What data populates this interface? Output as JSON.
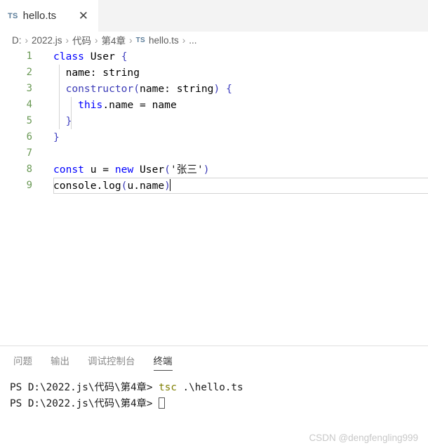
{
  "tabbar": {
    "tabs": [
      {
        "icon_label": "TS",
        "label": "hello.ts",
        "close_label": "✕"
      }
    ]
  },
  "breadcrumb": {
    "separator": "›",
    "ts_badge": "TS",
    "items": [
      "D:",
      "2022.js",
      "代码",
      "第4章",
      "hello.ts",
      "..."
    ]
  },
  "editor": {
    "lines": [
      {
        "num": "1",
        "segments": [
          {
            "t": "class",
            "c": "tok-kw"
          },
          {
            "t": " ",
            "c": "tok-plain"
          },
          {
            "t": "User",
            "c": "tok-plain"
          },
          {
            "t": " ",
            "c": "tok-plain"
          },
          {
            "t": "{",
            "c": "tok-brace"
          }
        ]
      },
      {
        "num": "2",
        "segments": [
          {
            "t": "  name: string",
            "c": "tok-plain"
          }
        ]
      },
      {
        "num": "3",
        "segments": [
          {
            "t": "  ",
            "c": "tok-plain"
          },
          {
            "t": "constructor",
            "c": "tok-fn"
          },
          {
            "t": "(",
            "c": "tok-paren"
          },
          {
            "t": "name: string",
            "c": "tok-plain"
          },
          {
            "t": ")",
            "c": "tok-paren"
          },
          {
            "t": " ",
            "c": "tok-plain"
          },
          {
            "t": "{",
            "c": "tok-brace"
          }
        ]
      },
      {
        "num": "4",
        "segments": [
          {
            "t": "    ",
            "c": "tok-plain"
          },
          {
            "t": "this",
            "c": "tok-this"
          },
          {
            "t": ".name = name",
            "c": "tok-plain"
          }
        ]
      },
      {
        "num": "5",
        "segments": [
          {
            "t": "  ",
            "c": "tok-plain"
          },
          {
            "t": "}",
            "c": "tok-brace"
          }
        ]
      },
      {
        "num": "6",
        "segments": [
          {
            "t": "}",
            "c": "tok-brace"
          }
        ]
      },
      {
        "num": "7",
        "segments": [
          {
            "t": "",
            "c": "tok-plain"
          }
        ]
      },
      {
        "num": "8",
        "segments": [
          {
            "t": "const",
            "c": "tok-kw"
          },
          {
            "t": " u = ",
            "c": "tok-plain"
          },
          {
            "t": "new",
            "c": "tok-kw"
          },
          {
            "t": " User",
            "c": "tok-plain"
          },
          {
            "t": "(",
            "c": "tok-paren"
          },
          {
            "t": "'张三'",
            "c": "tok-str"
          },
          {
            "t": ")",
            "c": "tok-paren"
          }
        ]
      },
      {
        "num": "9",
        "active": true,
        "cursor": true,
        "segments": [
          {
            "t": "console.log",
            "c": "tok-plain"
          },
          {
            "t": "(",
            "c": "tok-paren"
          },
          {
            "t": "u.name",
            "c": "tok-plain"
          },
          {
            "t": ")",
            "c": "tok-paren"
          }
        ]
      }
    ]
  },
  "panel": {
    "tabs": [
      {
        "label": "问题",
        "active": false
      },
      {
        "label": "输出",
        "active": false
      },
      {
        "label": "调试控制台",
        "active": false
      },
      {
        "label": "终端",
        "active": true
      }
    ],
    "terminal": {
      "lines": [
        {
          "prompt": "PS D:\\2022.js\\代码\\第4章> ",
          "command": "tsc",
          "arg": " .\\hello.ts",
          "cursor": false
        },
        {
          "prompt": "PS D:\\2022.js\\代码\\第4章> ",
          "command": "",
          "arg": "",
          "cursor": true
        }
      ]
    }
  },
  "watermark": {
    "text": "CSDN @dengfengling999"
  },
  "colors": {
    "keyword": "#0000ff",
    "function": "#3b3bb7",
    "linenumber": "#6a9955",
    "terminal_command": "#7e7e00",
    "tab_icon": "#5b7d9a",
    "panel_tab_active": "#333333",
    "background": "#ffffff",
    "tabbar_background": "#f3f3f3"
  }
}
